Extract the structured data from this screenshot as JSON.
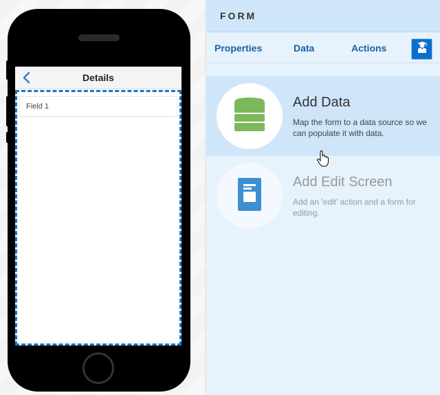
{
  "preview": {
    "screen": {
      "nav_title": "Details",
      "fields": [
        {
          "label": "Field 1"
        }
      ]
    }
  },
  "panel": {
    "title": "FORM",
    "tabs": [
      {
        "label": "Properties"
      },
      {
        "label": "Data"
      },
      {
        "label": "Actions"
      }
    ],
    "tab_icon": "graduate-icon",
    "cards": [
      {
        "title": "Add Data",
        "description": "Map the form to a data source so we can populate it with data.",
        "icon": "database-icon",
        "state": "hovered"
      },
      {
        "title": "Add Edit Screen",
        "description": "Add an 'edit' action and a form for editing.",
        "icon": "document-icon",
        "state": "disabled"
      }
    ]
  },
  "colors": {
    "accent": "#0a6fcc",
    "tab_text": "#1a5fa8",
    "database_icon": "#7cb85c",
    "document_icon": "#3d8fd1",
    "dashed_border": "#1a73c8"
  }
}
